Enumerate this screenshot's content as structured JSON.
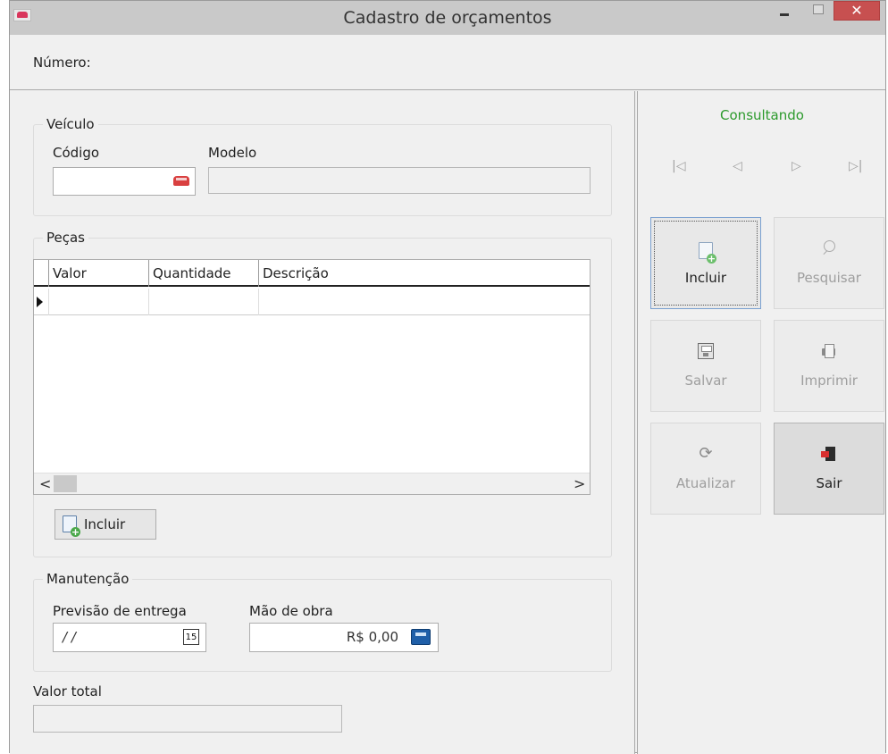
{
  "window": {
    "title": "Cadastro de orçamentos",
    "close_glyph": "✕"
  },
  "header": {
    "number_label": "Número:"
  },
  "vehicle": {
    "group_label": "Veículo",
    "code_label": "Código",
    "model_label": "Modelo",
    "code_value": "",
    "model_value": ""
  },
  "parts": {
    "group_label": "Peças",
    "columns": [
      "Valor",
      "Quantidade",
      "Descrição"
    ],
    "rows": [
      {
        "valor": "",
        "quantidade": "",
        "descricao": ""
      }
    ],
    "add_button_label": "Incluir",
    "scroll_left": "<",
    "scroll_right": ">"
  },
  "maintenance": {
    "group_label": "Manutenção",
    "delivery_label": "Previsão de entrega",
    "delivery_value": "/ /",
    "calendar_glyph": "15",
    "labor_label": "Mão de obra",
    "labor_value": "R$ 0,00"
  },
  "total": {
    "label": "Valor total",
    "value": ""
  },
  "side": {
    "status": "Consultando",
    "status_color": "#2c9a2c",
    "nav": {
      "first": "|◁",
      "prev": "◁",
      "next": "▷",
      "last": "▷|"
    },
    "buttons": {
      "incluir": "Incluir",
      "pesquisar": "Pesquisar",
      "salvar": "Salvar",
      "imprimir": "Imprimir",
      "atualizar": "Atualizar",
      "sair": "Sair"
    },
    "refresh_glyph": "⟳"
  }
}
